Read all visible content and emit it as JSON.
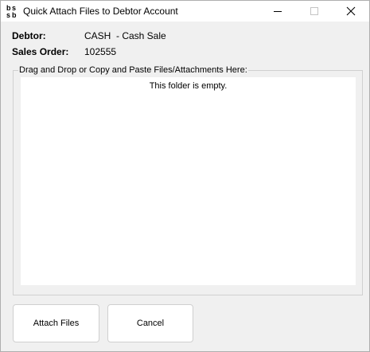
{
  "window": {
    "title": "Quick Attach Files to Debtor Account"
  },
  "fields": {
    "debtor_label": "Debtor:",
    "debtor_code": "CASH",
    "debtor_name": "- Cash Sale",
    "sales_order_label": "Sales Order:",
    "sales_order_value": "102555"
  },
  "dropzone": {
    "legend": "Drag and Drop or Copy and Paste Files/Attachments Here:",
    "empty_message": "This folder is empty."
  },
  "buttons": {
    "attach_label": "Attach Files",
    "cancel_label": "Cancel"
  },
  "icons": {
    "app": "bs-app-icon",
    "minimize": "minimize-icon",
    "maximize": "maximize-icon",
    "close": "close-icon"
  }
}
